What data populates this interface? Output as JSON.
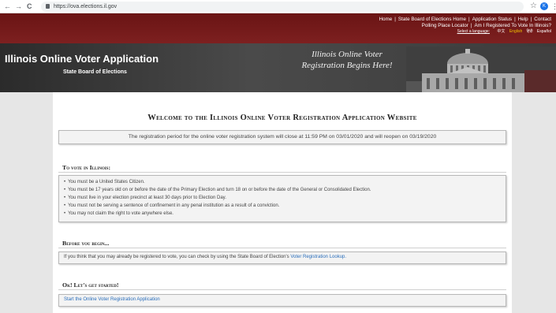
{
  "browser": {
    "back": "←",
    "forward": "→",
    "reload": "C",
    "url": "https://ova.elections.il.gov",
    "star": "☆",
    "avatar_initial": "K",
    "menu": "⋮"
  },
  "top_nav": {
    "row1": [
      "Home",
      "State Board of Elections Home",
      "Application Status",
      "Help",
      "Contact"
    ],
    "row2": [
      "Polling Place Locator",
      "Am I Registered To Vote In Illinois?"
    ],
    "language_label": "Select a language:",
    "languages": [
      "中文",
      "English",
      "हिंदी",
      "Español"
    ],
    "selected_language": "English"
  },
  "banner": {
    "title": "Illinois Online Voter Application",
    "subtitle": "State Board of Elections",
    "slogan_line1": "Illinois Online Voter",
    "slogan_line2": "Registration Begins Here!"
  },
  "main": {
    "heading": "Welcome to the Illinois Online Voter Registration Application Website",
    "notice": "The registration period for the online voter registration system will close at 11:59 PM on 03/01/2020 and will reopen on 03/19/2020",
    "to_vote": {
      "heading": "To vote in Illinois:",
      "items": [
        "You must be a United States Citizen.",
        "You must be 17 years old on or before the date of the Primary Election and turn 18 on or before the date of the General or Consolidated Election.",
        "You must live in your election precinct at least 30 days prior to Election Day.",
        "You must not be serving a sentence of confinement in any penal institution as a result of a conviction.",
        "You may not claim the right to vote anywhere else."
      ]
    },
    "before": {
      "heading": "Before you begin...",
      "text": "If you think that you may already be registered to vote, you can check by using the State Board of Election's",
      "link": "Voter Registration Lookup."
    },
    "start": {
      "heading": "Ok! Let's get started!",
      "link": "Start the Online Voter Registration Application"
    }
  },
  "colors": {
    "top_band": "#7d2020",
    "banner": "#3c3c3c",
    "link": "#2a6ebb",
    "selected_language": "#f2c200"
  }
}
